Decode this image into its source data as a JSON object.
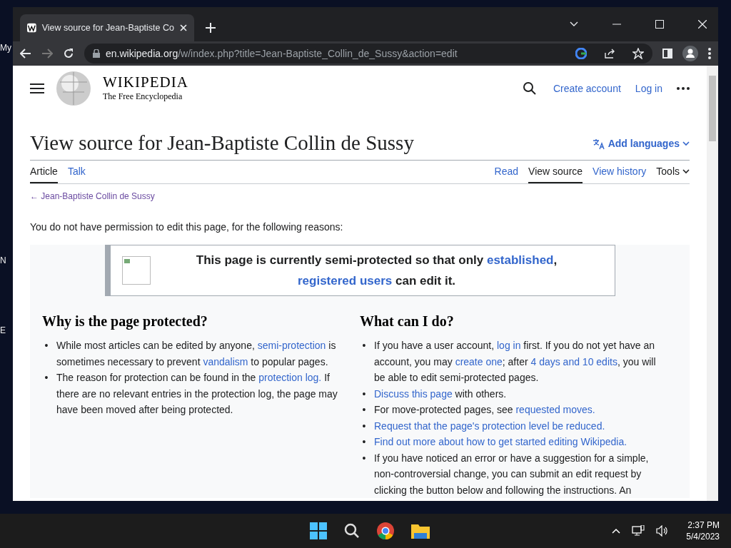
{
  "desktop_icons": [
    {
      "label": "My"
    },
    {
      "label": "N"
    },
    {
      "label": "E"
    }
  ],
  "browser": {
    "tab_title": "View source for Jean-Baptiste Co",
    "url_host": "en.wikipedia.org",
    "url_path": "/w/index.php?title=Jean-Baptiste_Collin_de_Sussy&action=edit"
  },
  "header": {
    "wordmark": "WIKIPEDIA",
    "tagline": "The Free Encyclopedia",
    "links": [
      "Create account",
      "Log in"
    ]
  },
  "page": {
    "title": "View source for Jean-Baptiste Collin de Sussy",
    "languages": "Add languages",
    "tabs_left": [
      {
        "label": "Article",
        "selected": true
      },
      {
        "label": "Talk",
        "selected": false
      }
    ],
    "tabs_right": [
      {
        "label": "Read",
        "selected": false,
        "kind": "link"
      },
      {
        "label": "View source",
        "selected": true,
        "kind": "link"
      },
      {
        "label": "View history",
        "selected": false,
        "kind": "link"
      },
      {
        "label": "Tools",
        "selected": false,
        "kind": "dropdown"
      }
    ],
    "back_link": "← Jean-Baptiste Collin de Sussy",
    "intro": "You do not have permission to edit this page, for the following reasons:",
    "notice": [
      [
        {
          "text": "This page is currently semi-protected so that only "
        },
        {
          "text": "established",
          "link": true
        },
        {
          "text": ","
        }
      ],
      [
        {
          "text": "registered users",
          "link": true
        },
        {
          "text": " can edit it."
        }
      ]
    ],
    "marker": "•",
    "columns": [
      {
        "heading": "Why is the page protected?",
        "items": [
          [
            {
              "text": "While most articles can be edited by anyone, "
            },
            {
              "text": "semi-protection",
              "link": true
            },
            {
              "text": " is sometimes necessary to prevent "
            },
            {
              "text": "vandalism",
              "link": true
            },
            {
              "text": " to popular pages."
            }
          ],
          [
            {
              "text": "The reason for protection can be found in the "
            },
            {
              "text": "protection log.",
              "link": true
            },
            {
              "text": " If there are no relevant entries in the protection log, the page may have been moved after being protected."
            }
          ]
        ]
      },
      {
        "heading": "What can I do?",
        "items": [
          [
            {
              "text": "If you have a user account, "
            },
            {
              "text": "log in",
              "link": true
            },
            {
              "text": " first. If you do not yet have an account, you may "
            },
            {
              "text": "create one",
              "link": true
            },
            {
              "text": "; after "
            },
            {
              "text": "4 days and 10 edits",
              "link": true
            },
            {
              "text": ", you will be able to edit semi-protected pages."
            }
          ],
          [
            {
              "text": "Discuss this page",
              "link": true
            },
            {
              "text": " with others."
            }
          ],
          [
            {
              "text": "For move-protected pages, see "
            },
            {
              "text": "requested moves.",
              "link": true
            }
          ],
          [
            {
              "text": "Request that the page's protection level be reduced.",
              "link": true
            }
          ],
          [
            {
              "text": "Find out more about how to get started editing Wikipedia.",
              "link": true
            }
          ],
          [
            {
              "text": "If you have noticed an error or have a suggestion for a simple, non-controversial change, you can submit an edit request by clicking the button below and following the instructions. An"
            }
          ]
        ]
      }
    ]
  },
  "taskbar": {
    "time": "2:37 PM",
    "date": "5/4/2023"
  }
}
